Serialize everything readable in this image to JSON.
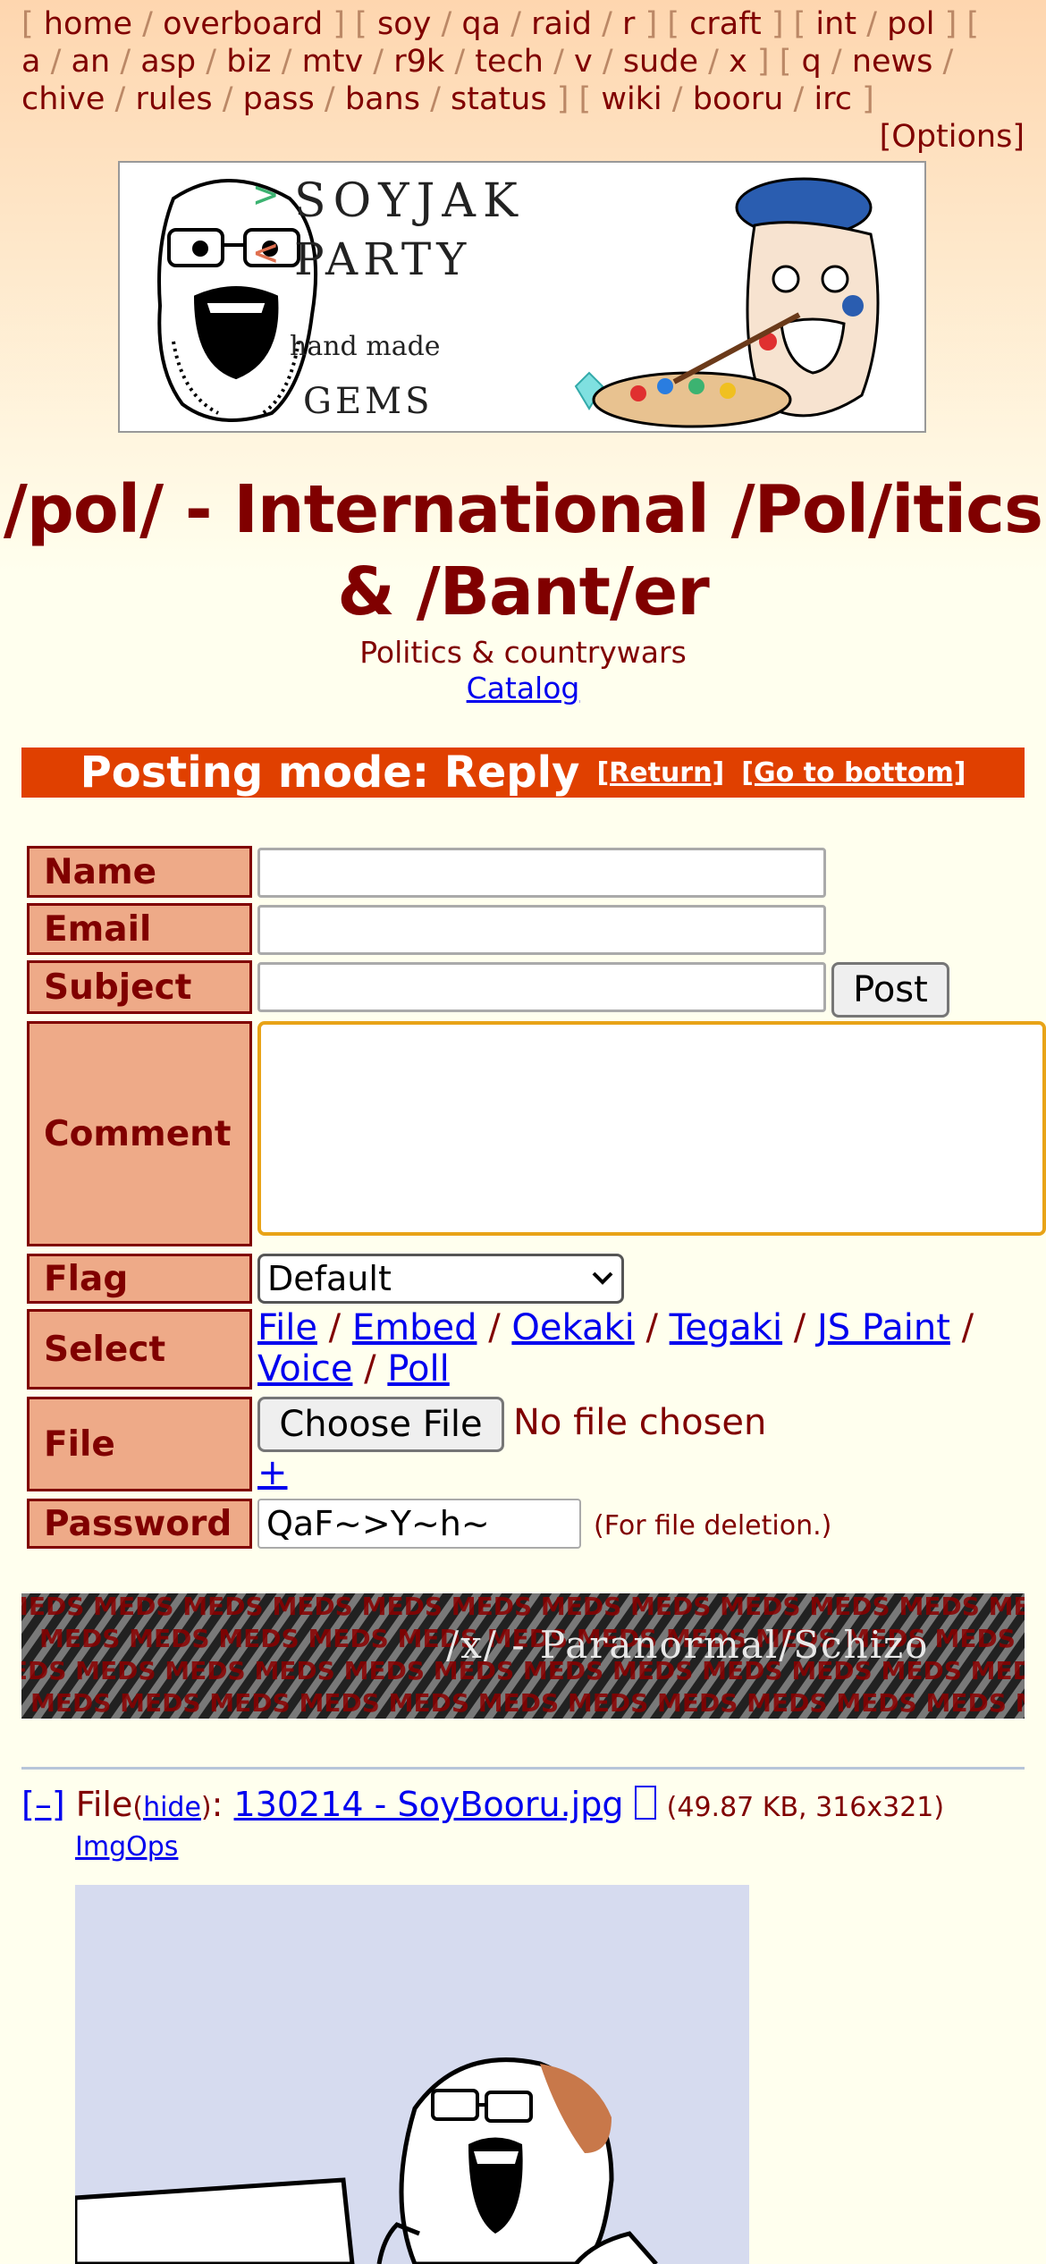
{
  "boardlist": {
    "group1": [
      "home",
      "overboard"
    ],
    "group2": [
      "soy",
      "qa",
      "raid",
      "r"
    ],
    "group3": [
      "craft"
    ],
    "group4": [
      "int",
      "pol"
    ],
    "group5": [
      "a",
      "an",
      "asp",
      "biz",
      "mtv",
      "r9k",
      "tech",
      "v",
      "sude",
      "x"
    ],
    "group6": [
      "q",
      "news",
      "chive",
      "rules",
      "pass",
      "bans",
      "status"
    ],
    "group7": [
      "wiki",
      "booru",
      "irc"
    ]
  },
  "options_label": "[Options]",
  "banner": {
    "line1": ">SOYJAK",
    "line2": "<PARTY",
    "line3": "hand made",
    "line4": "GEMS"
  },
  "board": {
    "title": "/pol/ - International /Pol/itics & /Bant/er",
    "subtitle": "Politics & countrywars",
    "catalog_link": "Catalog"
  },
  "posting_mode": {
    "label": "Posting mode: Reply",
    "return_link": "[Return]",
    "bottom_link": "[Go to bottom]"
  },
  "form": {
    "name_label": "Name",
    "email_label": "Email",
    "subject_label": "Subject",
    "post_button": "Post",
    "comment_label": "Comment",
    "flag_label": "Flag",
    "flag_selected": "Default",
    "select_label": "Select",
    "select_options": [
      "File",
      "Embed",
      "Oekaki",
      "Tegaki",
      "JS Paint",
      "Voice",
      "Poll"
    ],
    "file_label": "File",
    "choose_file_button": "Choose File",
    "no_file_text": "No file chosen",
    "add_file": "+",
    "password_label": "Password",
    "password_value": "QaF~>Y~h~",
    "password_note": "(For file deletion.)"
  },
  "divider_banner": {
    "text": "/x/ - Paranormal/Schizo",
    "background_word": "MEDS"
  },
  "post": {
    "collapse": "[–]",
    "file_prefix": "File",
    "hide_link": "hide",
    "filename": "130214 - SoyBooru.jpg",
    "file_meta": "(49.87 KB, 316x321)",
    "imgops": "ImgOps"
  },
  "colors": {
    "accent": "#800000",
    "mode_bar": "#e04000",
    "label_bg": "#eeaa88",
    "focus": "#e8a317"
  }
}
